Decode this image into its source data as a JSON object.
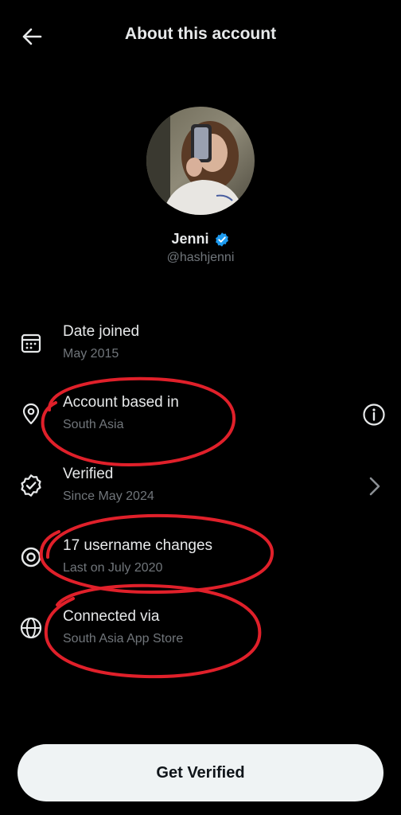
{
  "header": {
    "title": "About this account",
    "back_icon": "arrow-left-icon"
  },
  "profile": {
    "name": "Jenni",
    "handle": "@hashjenni",
    "verified_badge_color": "#1d9bf0"
  },
  "details": [
    {
      "icon": "calendar-icon",
      "label": "Date joined",
      "value": "May 2015"
    },
    {
      "icon": "location-pin-icon",
      "label": "Account based in",
      "value": "South Asia",
      "trailing_icon": "info-icon"
    },
    {
      "icon": "verified-badge-icon",
      "label": "Verified",
      "value": "Since May 2024",
      "trailing_icon": "chevron-right-icon"
    },
    {
      "icon": "username-at-icon",
      "label": "17 username changes",
      "value": "Last on July 2020"
    },
    {
      "icon": "globe-icon",
      "label": "Connected via",
      "value": "South Asia App Store"
    }
  ],
  "cta": {
    "label": "Get Verified"
  },
  "colors": {
    "background": "#000000",
    "primary_text": "#e7e9ea",
    "secondary_text": "#71767b",
    "annotation": "#e0202a",
    "button_bg": "#eff3f4"
  }
}
